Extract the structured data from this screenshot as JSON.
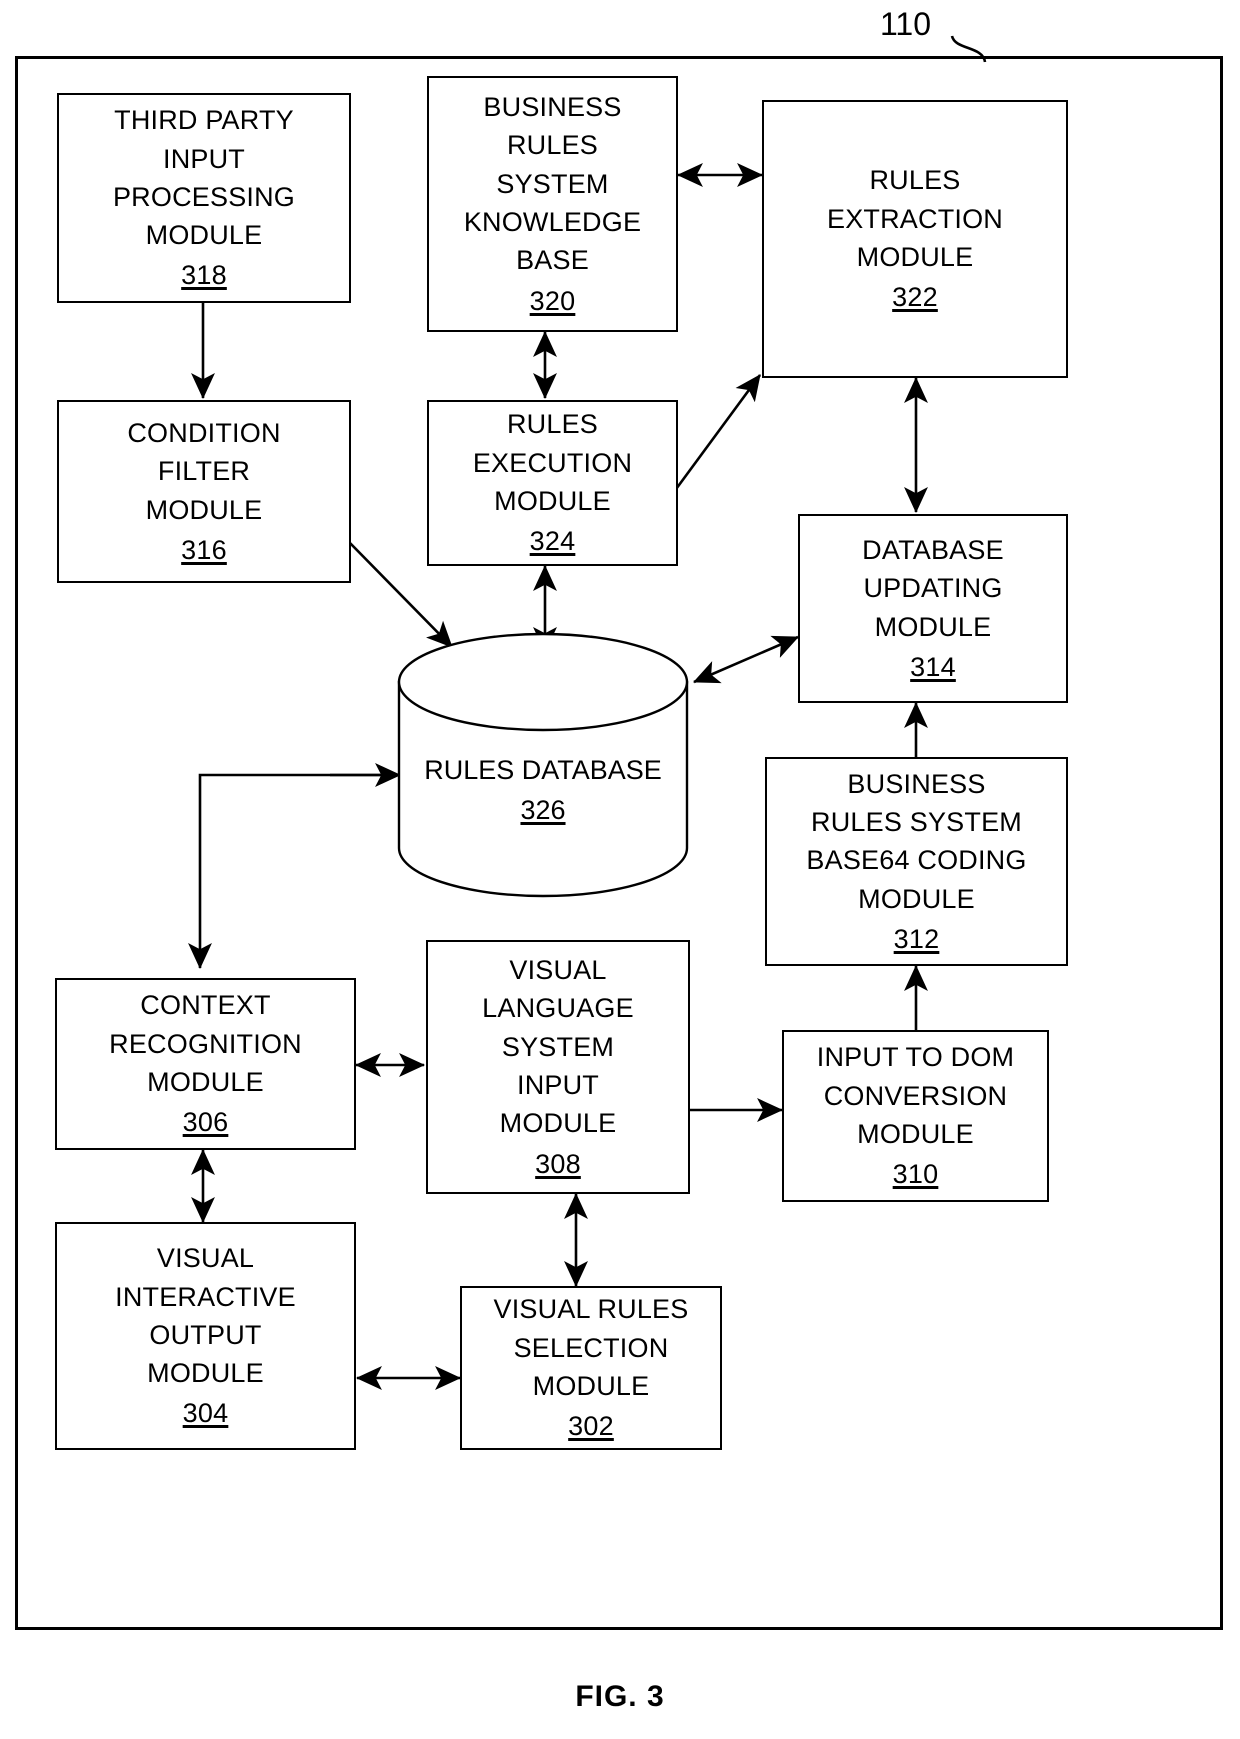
{
  "figure": {
    "caption": "FIG. 3",
    "system_reference": "110"
  },
  "nodes": {
    "third_party_input": {
      "lines": [
        "THIRD PARTY",
        "INPUT",
        "PROCESSING",
        "MODULE"
      ],
      "ref": "318"
    },
    "business_rules_kb": {
      "lines": [
        "BUSINESS",
        "RULES",
        "SYSTEM",
        "KNOWLEDGE",
        "BASE"
      ],
      "ref": "320"
    },
    "rules_extraction": {
      "lines": [
        "RULES",
        "EXTRACTION",
        "MODULE"
      ],
      "ref": "322"
    },
    "condition_filter": {
      "lines": [
        "CONDITION",
        "FILTER",
        "MODULE"
      ],
      "ref": "316"
    },
    "rules_execution": {
      "lines": [
        "RULES",
        "EXECUTION",
        "MODULE"
      ],
      "ref": "324"
    },
    "database_updating": {
      "lines": [
        "DATABASE",
        "UPDATING",
        "MODULE"
      ],
      "ref": "314"
    },
    "rules_database": {
      "lines": [
        "RULES",
        "DATABASE"
      ],
      "ref": "326"
    },
    "base64_coding": {
      "lines": [
        "BUSINESS",
        "RULES SYSTEM",
        "BASE64 CODING",
        "MODULE"
      ],
      "ref": "312"
    },
    "context_recognition": {
      "lines": [
        "CONTEXT",
        "RECOGNITION",
        "MODULE"
      ],
      "ref": "306"
    },
    "visual_language_input": {
      "lines": [
        "VISUAL",
        "LANGUAGE",
        "SYSTEM",
        "INPUT",
        "MODULE"
      ],
      "ref": "308"
    },
    "input_to_dom": {
      "lines": [
        "INPUT TO DOM",
        "CONVERSION",
        "MODULE"
      ],
      "ref": "310"
    },
    "visual_interactive_output": {
      "lines": [
        "VISUAL",
        "INTERACTIVE",
        "OUTPUT",
        "MODULE"
      ],
      "ref": "304"
    },
    "visual_rules_selection": {
      "lines": [
        "VISUAL RULES",
        "SELECTION",
        "MODULE"
      ],
      "ref": "302"
    }
  },
  "connections": [
    {
      "from": "318",
      "to": "316",
      "type": "arrow"
    },
    {
      "from": "320",
      "to": "322",
      "type": "double-arrow"
    },
    {
      "from": "320",
      "to": "324",
      "type": "double-arrow"
    },
    {
      "from": "324",
      "to": "322",
      "type": "arrow"
    },
    {
      "from": "324",
      "to": "326",
      "type": "double-arrow"
    },
    {
      "from": "316",
      "to": "326",
      "type": "arrow"
    },
    {
      "from": "322",
      "to": "314",
      "type": "double-arrow"
    },
    {
      "from": "314",
      "to": "326",
      "type": "double-arrow"
    },
    {
      "from": "312",
      "to": "314",
      "type": "arrow"
    },
    {
      "from": "310",
      "to": "312",
      "type": "arrow"
    },
    {
      "from": "326",
      "to": "306",
      "type": "arrow"
    },
    {
      "from": "306",
      "to": "308",
      "type": "double-arrow"
    },
    {
      "from": "306",
      "to": "304",
      "type": "double-arrow"
    },
    {
      "from": "308",
      "to": "310",
      "type": "arrow"
    },
    {
      "from": "308",
      "to": "302",
      "type": "double-arrow"
    },
    {
      "from": "304",
      "to": "302",
      "type": "double-arrow"
    }
  ],
  "colors": {
    "line": "#000000",
    "background": "#ffffff"
  }
}
